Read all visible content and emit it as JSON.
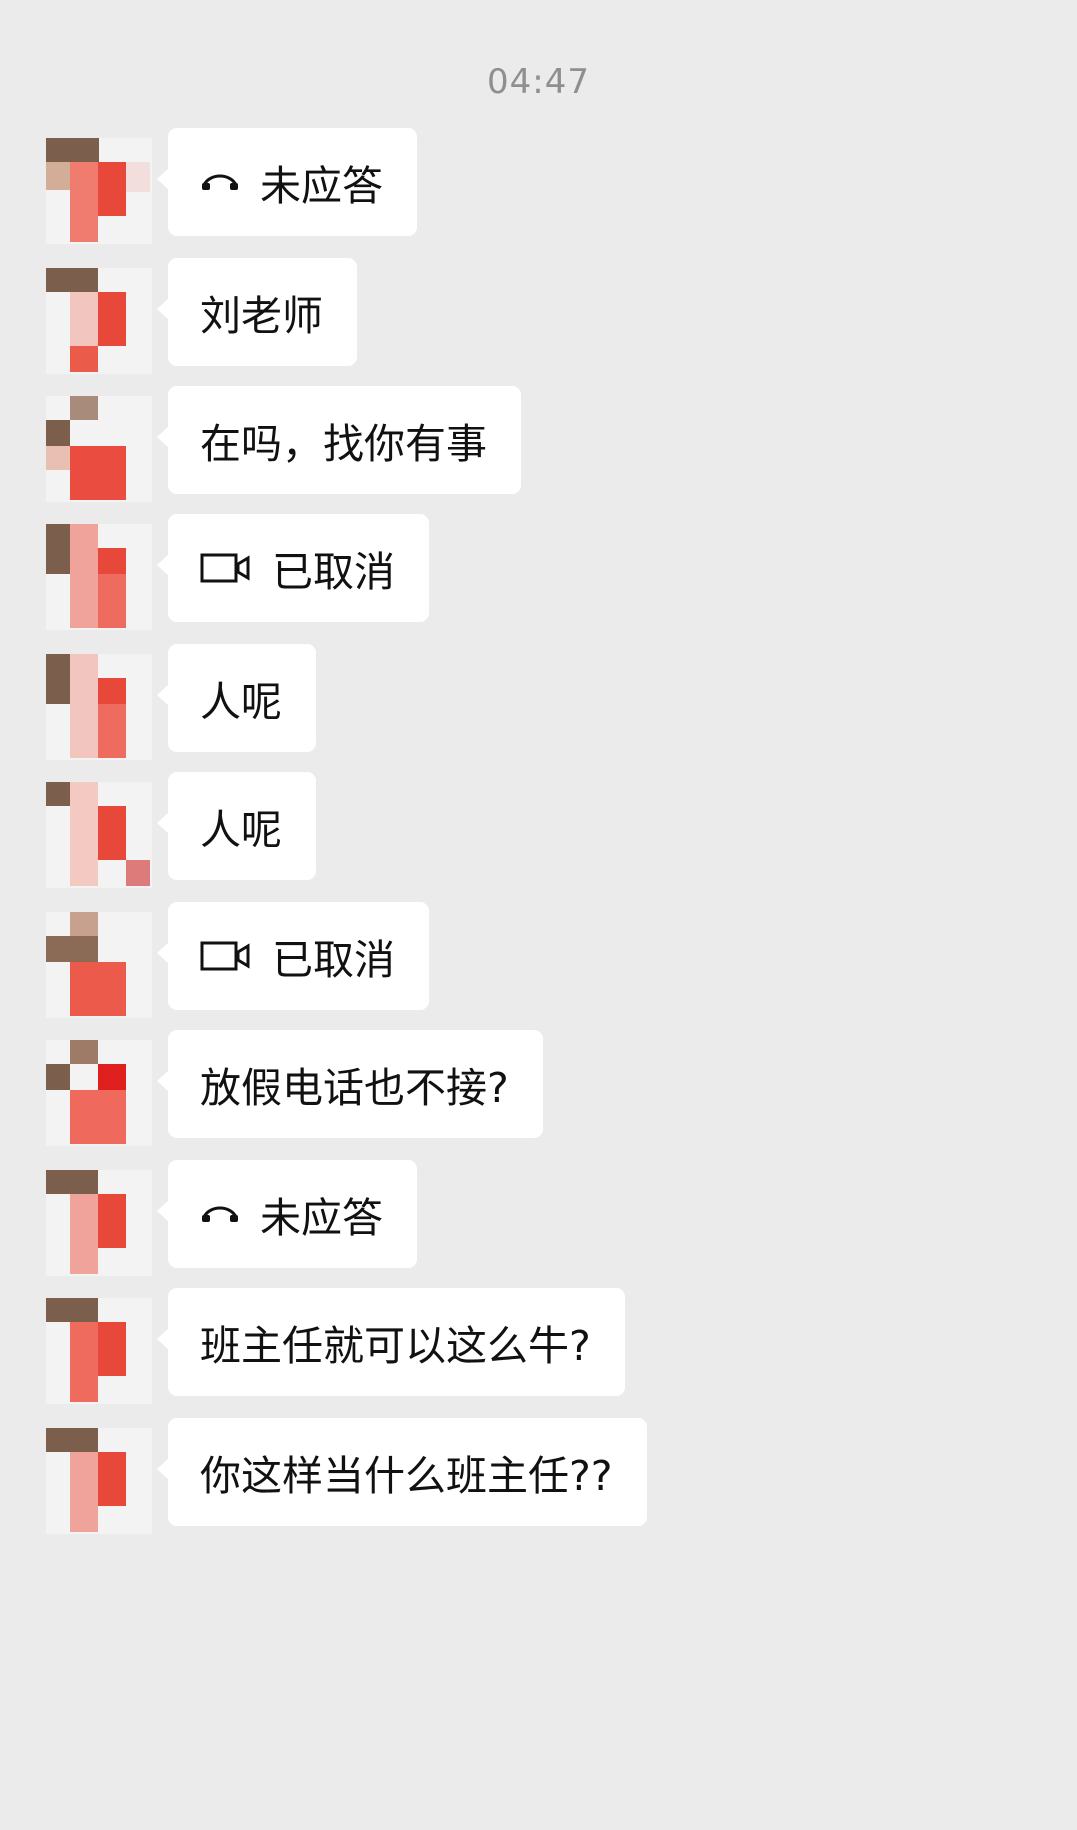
{
  "chat": {
    "timestamp": "04:47",
    "messages": [
      {
        "type": "call",
        "icon": "phone-icon",
        "text": "未应答"
      },
      {
        "type": "text",
        "text": "刘老师"
      },
      {
        "type": "text",
        "text": "在吗，找你有事"
      },
      {
        "type": "video",
        "icon": "video-camera-icon",
        "text": "已取消"
      },
      {
        "type": "text",
        "text": "人呢"
      },
      {
        "type": "text",
        "text": "人呢"
      },
      {
        "type": "video",
        "icon": "video-camera-icon",
        "text": "已取消"
      },
      {
        "type": "text",
        "text": "放假电话也不接?"
      },
      {
        "type": "call",
        "icon": "phone-icon",
        "text": "未应答"
      },
      {
        "type": "text",
        "text": "班主任就可以这么牛?"
      },
      {
        "type": "text",
        "text": "你这样当什么班主任??"
      }
    ]
  },
  "colors": {
    "background": "#ebebeb",
    "bubble": "#ffffff",
    "avatar_red": "#e8483a",
    "avatar_brown": "#7d5f4b"
  }
}
